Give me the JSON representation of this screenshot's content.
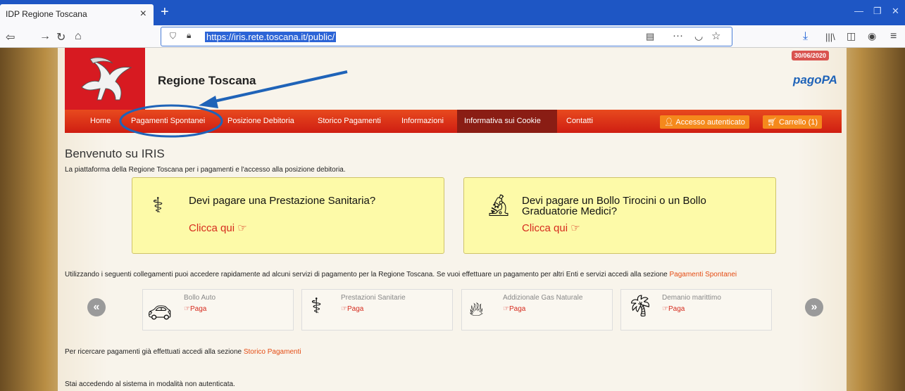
{
  "browser": {
    "tab_title": "IDP Regione Toscana",
    "tab_close": "×",
    "new_tab": "+",
    "url": "https://iris.rete.toscana.it/public/",
    "page_actions": "···"
  },
  "header": {
    "site_title": "Regione Toscana",
    "date_badge": "30/06/2020",
    "pagopa": "pagoPA"
  },
  "menu": {
    "items": [
      "Home",
      "Pagamenti Spontanei",
      "Posizione Debitoria",
      "Storico Pagamenti",
      "Informazioni",
      "Informativa sui Cookie",
      "Contatti"
    ],
    "login": "Accesso autenticato",
    "cart": "Carrello (1)"
  },
  "main": {
    "welcome": "Benvenuto su IRIS",
    "intro": "La piattaforma della Regione Toscana per i pagamenti e l'accesso alla posizione debitoria.",
    "card1_title": "Devi pagare una Prestazione Sanitaria?",
    "card2_title_line1": "Devi pagare un Bollo Tirocini o un Bollo",
    "card2_title_line2": "Graduatorie Medici?",
    "click_here": "Clicca qui",
    "links_intro": "Utilizzando i seguenti collegamenti puoi accedere rapidamente ad alcuni servizi di pagamento per la Regione Toscana. Se vuoi effettuare un pagamento per altri Enti e servizi accedi alla sezione ",
    "links_intro_link": "Pagamenti Spontanei",
    "services": [
      {
        "name": "Bollo Auto",
        "action": "Paga",
        "icon": "car-icon"
      },
      {
        "name": "Prestazioni Sanitarie",
        "action": "Paga",
        "icon": "caduceus-icon"
      },
      {
        "name": "Addizionale Gas Naturale",
        "action": "Paga",
        "icon": "flame-icon"
      },
      {
        "name": "Demanio marittimo",
        "action": "Paga",
        "icon": "palm-icon"
      }
    ],
    "storico_text": "Per ricercare pagamenti già effettuati accedi alla sezione ",
    "storico_link": "Storico Pagamenti",
    "not_auth": "Stai accedendo al sistema in modalità non autenticata."
  },
  "colors": {
    "menu_red": "#d71a21",
    "accent_orange": "#f5891c",
    "annotation_blue": "#1f63b8"
  }
}
